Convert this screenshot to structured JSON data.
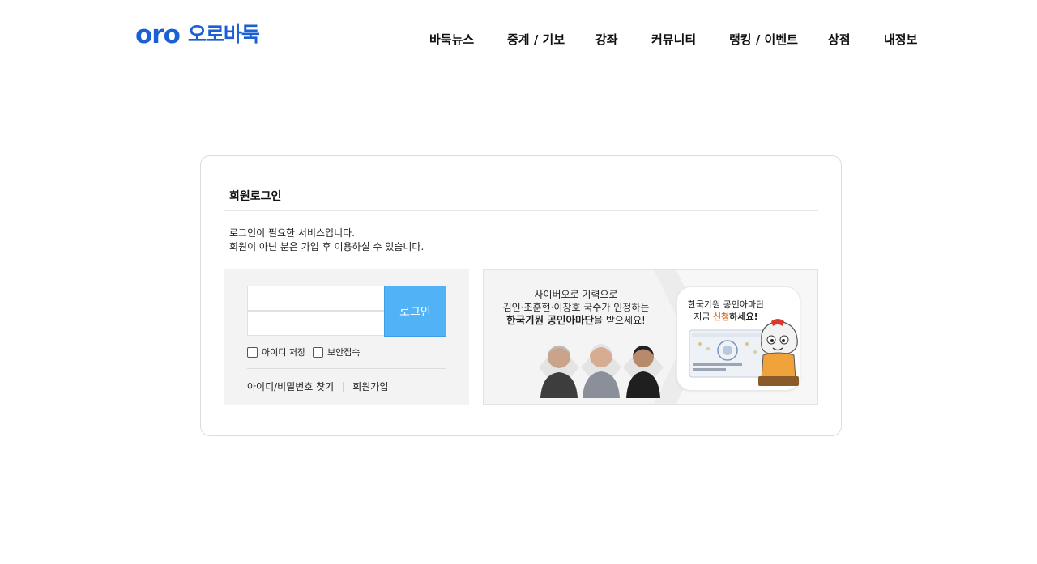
{
  "header": {
    "logo_en": "oro",
    "logo_ko": "오로바둑",
    "nav": [
      {
        "label": "바둑뉴스"
      },
      {
        "label": "중계 / 기보"
      },
      {
        "label": "강좌"
      },
      {
        "label": "커뮤니티"
      },
      {
        "label": "랭킹 / 이벤트"
      },
      {
        "label": "상점"
      },
      {
        "label": "내정보"
      }
    ]
  },
  "login": {
    "title": "회원로그인",
    "notice_line1": "로그인이 필요한 서비스입니다.",
    "notice_line2": "회원이 아닌 분은 가입 후 이용하실 수 있습니다.",
    "id_value": "",
    "pw_value": "",
    "button_label": "로그인",
    "save_id_label": "아이디 저장",
    "save_id_checked": false,
    "secure_label": "보안접속",
    "secure_checked": false,
    "find_label": "아이디/비밀번호 찾기",
    "signup_label": "회원가입"
  },
  "banner": {
    "line1": "사이버오로 기력으로",
    "line2": "김인·조훈현·이창호 국수가 인정하는",
    "line3_bold": "한국기원 공인아마단",
    "line3_rest": "을 받으세요!",
    "badge_line1": "한국기원 공인아마단",
    "badge_pre": "지금 ",
    "badge_highlight": "신청",
    "badge_post": "하세요!"
  },
  "colors": {
    "brand": "#1a5fd6",
    "login_button": "#51b2f5",
    "highlight": "#e8762c"
  }
}
